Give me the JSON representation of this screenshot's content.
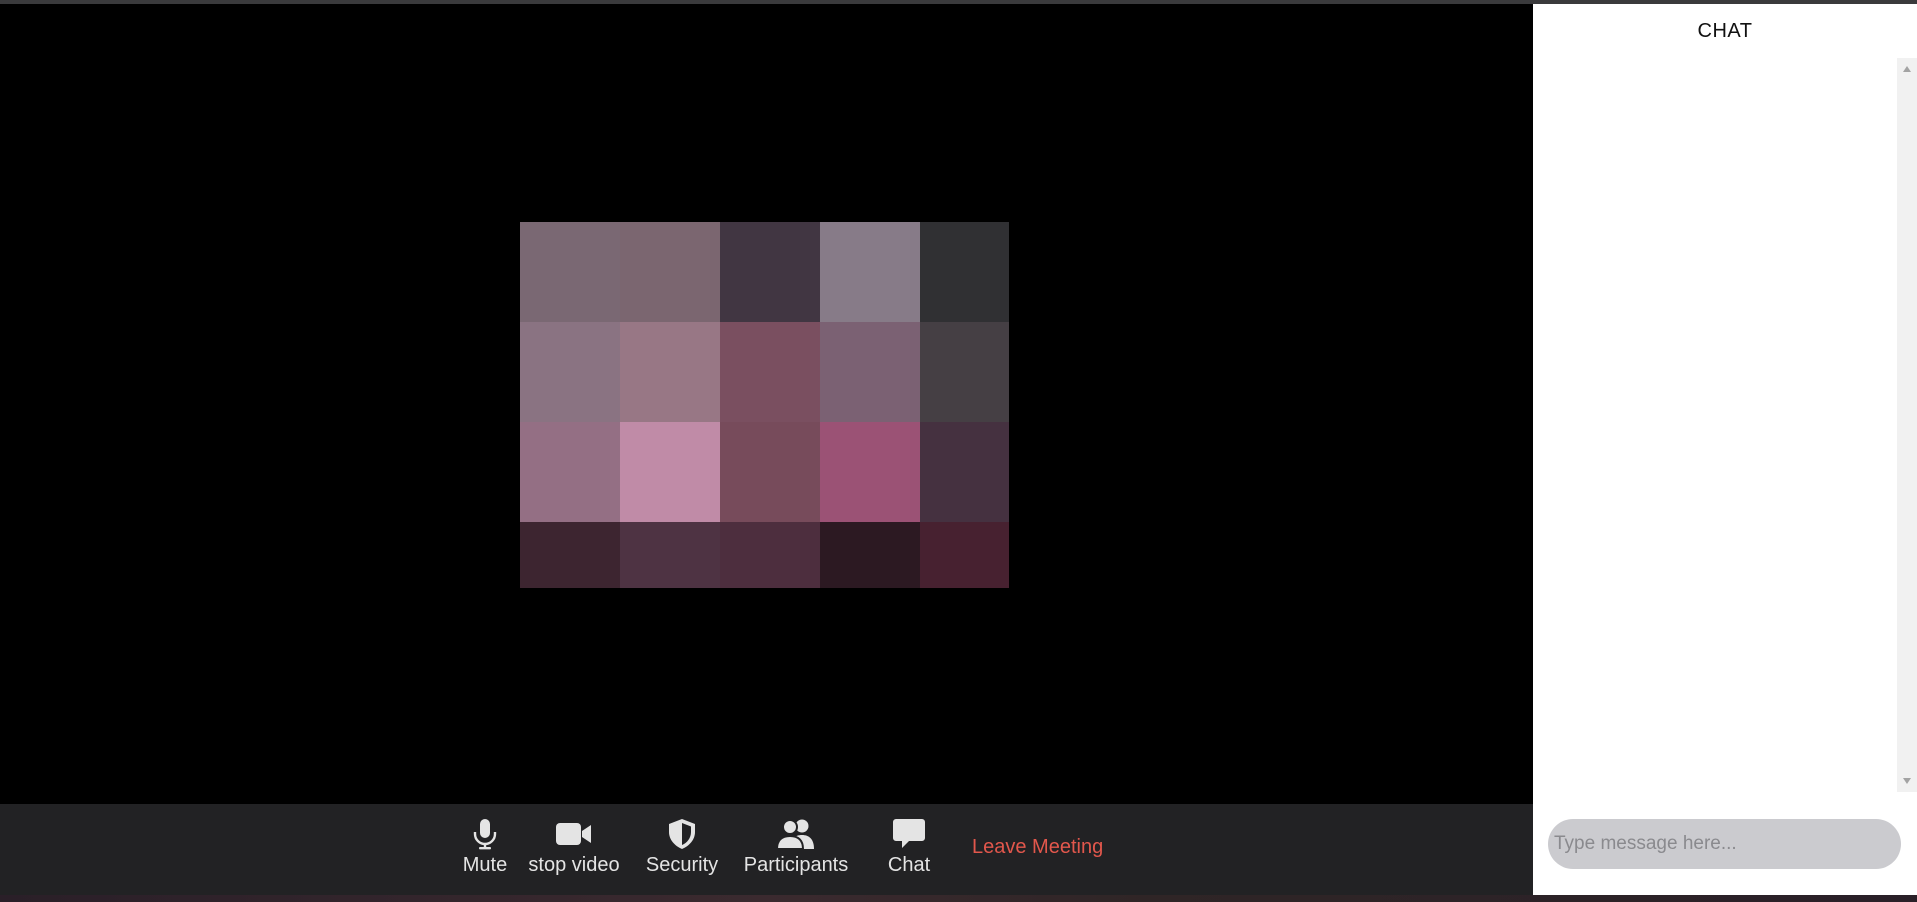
{
  "chat": {
    "title": "CHAT",
    "input_placeholder": "Type message here..."
  },
  "toolbar": {
    "mute_label": "Mute",
    "video_label": "stop video",
    "security_label": "Security",
    "participants_label": "Participants",
    "chat_label": "Chat",
    "leave_label": "Leave Meeting"
  },
  "icons": {
    "mute": "microphone-icon",
    "video": "video-camera-icon",
    "security": "shield-icon",
    "participants": "people-icon",
    "chat": "speech-bubble-icon"
  },
  "colors": {
    "toolbar_bg": "#222224",
    "leave": "#e2574c",
    "stage_bg": "#000000",
    "chat_bg": "#ffffff"
  },
  "video": {
    "type": "pixelated-participant-video",
    "tile_colors": [
      [
        "#7a6873",
        "#7b6670",
        "#413642",
        "#877b88",
        "#303033"
      ],
      [
        "#8a7382",
        "#987785",
        "#7a4f60",
        "#7b6173",
        "#453f44"
      ],
      [
        "#946f84",
        "#c08ba7",
        "#774b5b",
        "#9b5275",
        "#453140"
      ],
      [
        "#3d2530",
        "#4e3343",
        "#4d2e3e",
        "#2c1922",
        "#472130"
      ]
    ]
  }
}
